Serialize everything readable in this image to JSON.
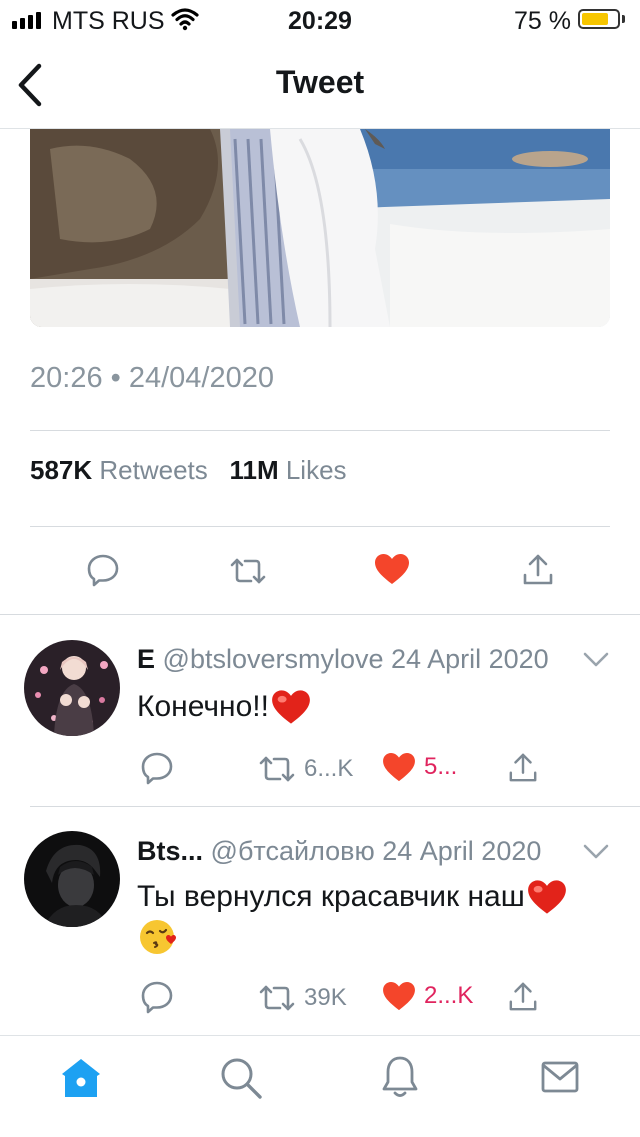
{
  "status_bar": {
    "carrier": "MTS RUS",
    "time": "20:29",
    "battery_percent": "75 %",
    "battery_level": 0.75
  },
  "header": {
    "title": "Tweet"
  },
  "tweet": {
    "timestamp": "20:26 • 24/04/2020",
    "retweet_count": "587K",
    "retweet_label": "Retweets",
    "like_count": "11M",
    "like_label": "Likes"
  },
  "replies": [
    {
      "name": "E",
      "handle": "@btsloversmylove",
      "date": "24 April 2020",
      "text_line1": "Конечно!!",
      "text_line2": "",
      "retweets": "6...K",
      "likes": "5..."
    },
    {
      "name": "Bts...",
      "handle": "@бтсайловю",
      "date": "24 April 2020",
      "text_line1": "Ты вернулся красавчик наш",
      "text_line2": "",
      "retweets": "39K",
      "likes": "2...K"
    }
  ],
  "colors": {
    "like_red": "#e0245e",
    "heart_red": "#f4452b",
    "brand_blue": "#1da1f2",
    "muted_grey": "#7d8994"
  },
  "icons": [
    "back-chevron-icon",
    "reply-icon",
    "retweet-icon",
    "like-heart-icon",
    "share-icon",
    "home-icon",
    "search-icon",
    "notifications-bell-icon",
    "messages-envelope-icon"
  ]
}
